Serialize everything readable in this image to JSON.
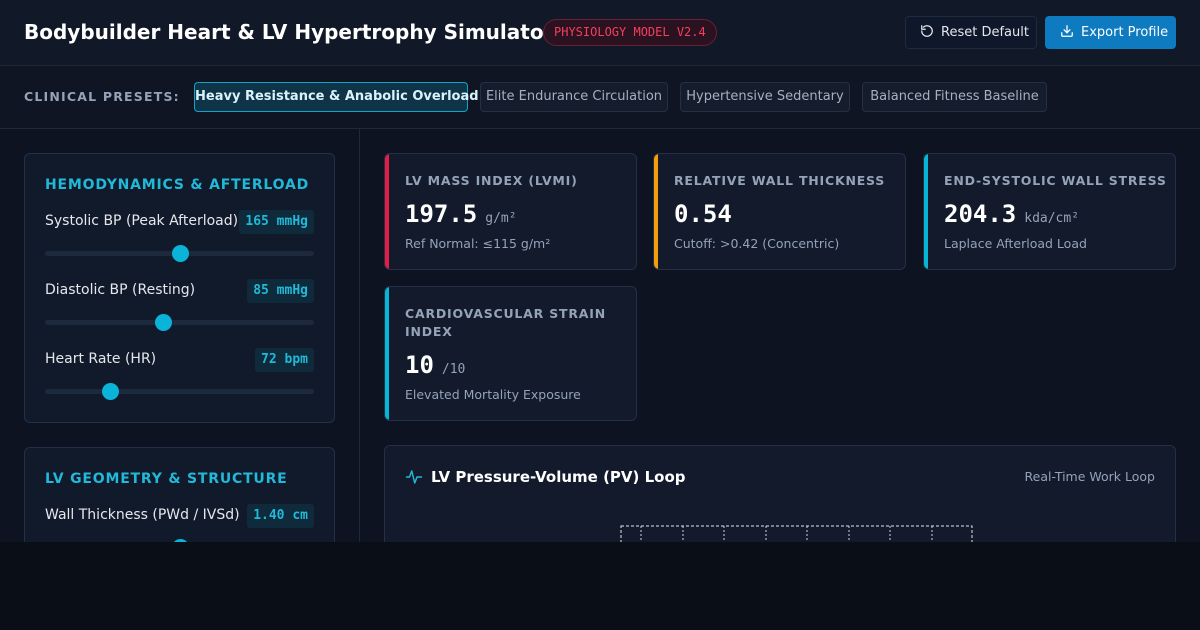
{
  "header": {
    "title": "Bodybuilder Heart & LV Hypertrophy Simulator",
    "badge": "PHYSIOLOGY MODEL V2.4",
    "reset_label": "Reset Default",
    "export_label": "Export Profile"
  },
  "presets": {
    "label": "CLINICAL PRESETS:",
    "items": [
      {
        "label": "Heavy Resistance & Anabolic Overload",
        "active": true
      },
      {
        "label": "Elite Endurance Circulation",
        "active": false
      },
      {
        "label": "Hypertensive Sedentary",
        "active": false
      },
      {
        "label": "Balanced Fitness Baseline",
        "active": false
      }
    ]
  },
  "hemodynamics": {
    "title": "HEMODYNAMICS & AFTERLOAD",
    "params": [
      {
        "label": "Systolic BP (Peak Afterload)",
        "value": "165 mmHg",
        "level": 0.5
      },
      {
        "label": "Diastolic BP (Resting)",
        "value": "85 mmHg",
        "level": 0.44
      },
      {
        "label": "Heart Rate (HR)",
        "value": "72 bpm",
        "level": 0.24
      }
    ]
  },
  "geometry": {
    "title": "LV GEOMETRY & STRUCTURE",
    "params": [
      {
        "label": "Wall Thickness (PWd / IVSd)",
        "value": "1.40 cm",
        "level": 0.5
      }
    ]
  },
  "metrics": [
    {
      "label": "LV MASS INDEX (LVMI)",
      "value": "197.5",
      "unit": "g/m²",
      "note": "Ref Normal: ≤115 g/m²",
      "accent": "#e11d48"
    },
    {
      "label": "RELATIVE WALL THICKNESS",
      "value": "0.54",
      "unit": "",
      "note": "Cutoff: >0.42 (Concentric)",
      "accent": "#f59e0b"
    },
    {
      "label": "END-SYSTOLIC WALL STRESS",
      "value": "204.3",
      "unit": "kda/cm²",
      "note": "Laplace Afterload Load",
      "accent": "#06b6d4"
    },
    {
      "label": "CARDIOVASCULAR STRAIN INDEX",
      "value": "10",
      "unit": "/10",
      "note": "Elevated Mortality Exposure",
      "accent": "#06b6d4"
    }
  ],
  "chart": {
    "title": "LV Pressure-Volume (PV) Loop",
    "subtitle": "Real-Time Work Loop",
    "icon": "pulse-icon"
  },
  "icons": {
    "reset": "rotate-ccw-icon",
    "export": "download-icon"
  }
}
